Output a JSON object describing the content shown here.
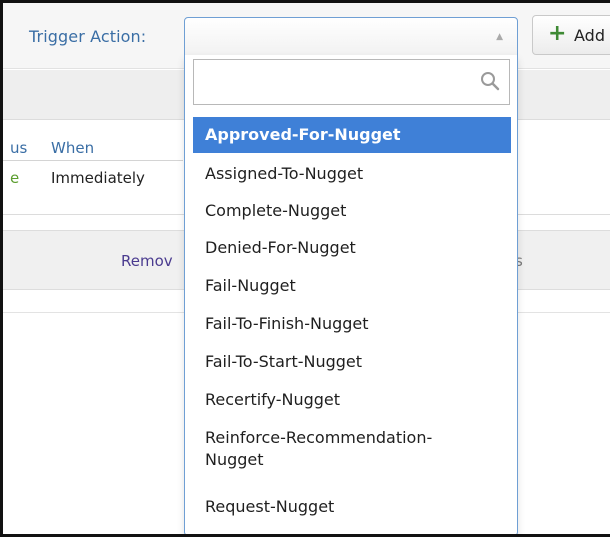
{
  "header": {
    "trigger_label": "Trigger Action:",
    "add_label": "Add",
    "add_icon": "plus-icon",
    "accent": "#3e8a34"
  },
  "table": {
    "status_header": "us",
    "when_header": "When",
    "status_value": "e",
    "when_value": "Immediately"
  },
  "actions": {
    "remove_label": "Remov",
    "trailing_text": "s"
  },
  "select": {
    "value": "",
    "search_placeholder": "",
    "arrow_icon": "triangle-up-icon",
    "search_icon": "magnifier-icon",
    "selected_color": "#3f80d7",
    "options": [
      "Approved-For-Nugget",
      "Assigned-To-Nugget",
      "Complete-Nugget",
      "Denied-For-Nugget",
      "Fail-Nugget",
      "Fail-To-Finish-Nugget",
      "Fail-To-Start-Nugget",
      "Recertify-Nugget",
      "Reinforce-Recommendation-Nugget",
      "Request-Nugget"
    ],
    "highlighted_option": "Approved-For-Nugget"
  }
}
